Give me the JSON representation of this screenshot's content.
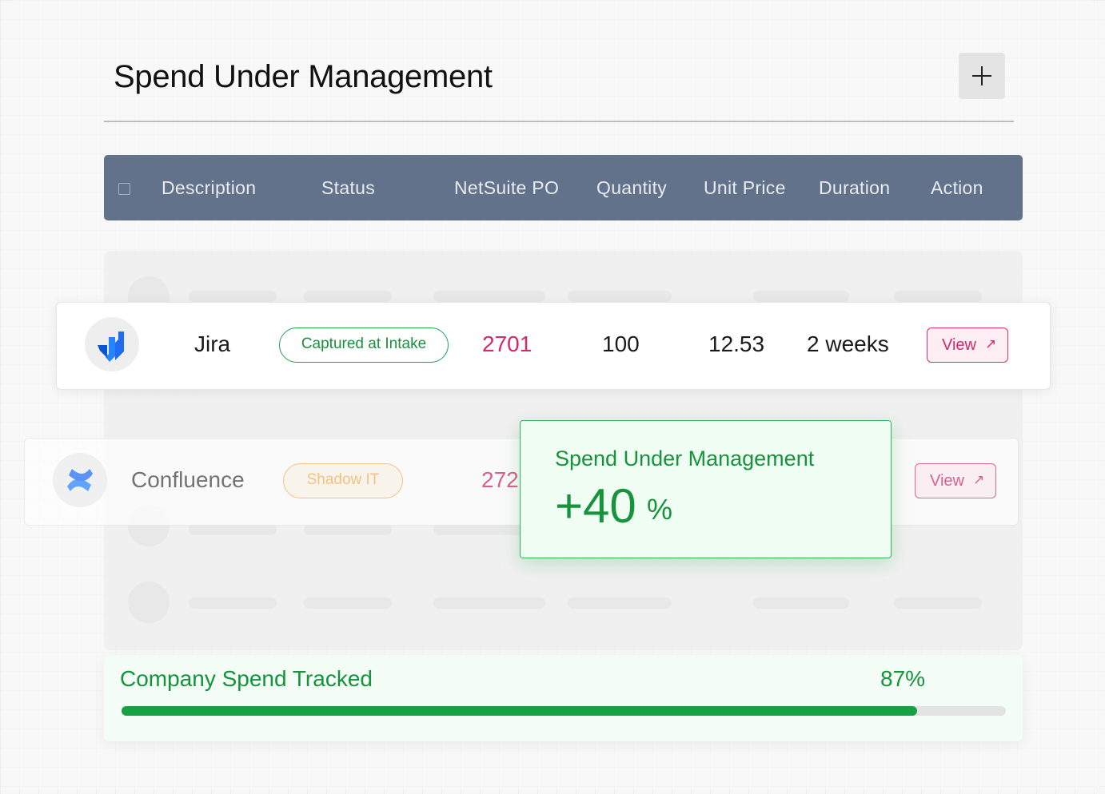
{
  "header": {
    "title": "Spend Under Management",
    "add_icon": "plus-icon"
  },
  "table": {
    "columns": [
      "Description",
      "Status",
      "NetSuite PO",
      "Quantity",
      "Unit Price",
      "Duration",
      "Action"
    ],
    "rows": [
      {
        "logo_icon": "jira-logo-icon",
        "description": "Jira",
        "status": "Captured at Intake",
        "status_color": "#22a14a",
        "po": "2701",
        "po_color": "#d12a66",
        "quantity": "100",
        "unit_price": "12.53",
        "duration": "2 weeks",
        "action": "View",
        "action_icon": "arrow-up-right-icon"
      },
      {
        "logo_icon": "confluence-logo-icon",
        "description": "Confluence",
        "status": "Shadow IT",
        "status_color": "#f1b35a",
        "po": "272",
        "po_color": "#d12a66",
        "action": "View",
        "action_icon": "arrow-up-right-icon"
      }
    ]
  },
  "highlight": {
    "label": "Spend Under Management",
    "value": "+40",
    "unit": "%",
    "color": "#17923d"
  },
  "tracker": {
    "label": "Company Spend Tracked",
    "percent_text": "87%",
    "progress": 0.9,
    "color": "#17a145"
  }
}
